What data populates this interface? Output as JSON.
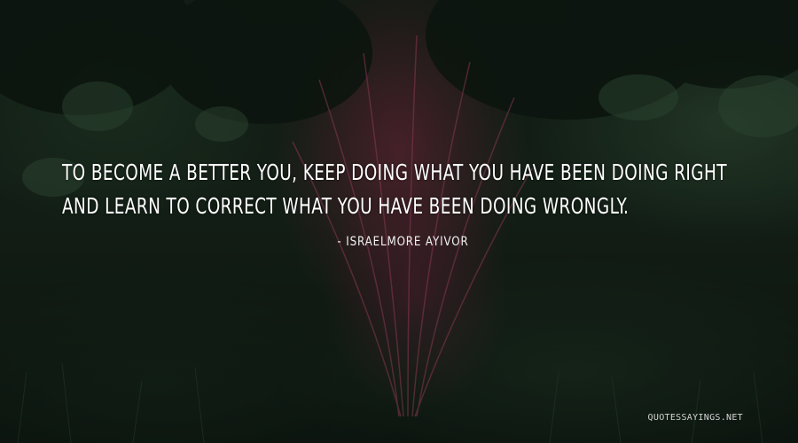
{
  "image": {
    "quote_lines": [
      "To become a better you, keep doing what you have been doing right",
      "and learn to correct what you have been doing wrongly."
    ],
    "author": "- Israelmore Ayivor",
    "watermark": "QUOTESSAYINGS.NET",
    "colors": {
      "text": "#ffffff",
      "foliage_dark": "#16241a",
      "plant_pink": "#962d4b"
    }
  }
}
